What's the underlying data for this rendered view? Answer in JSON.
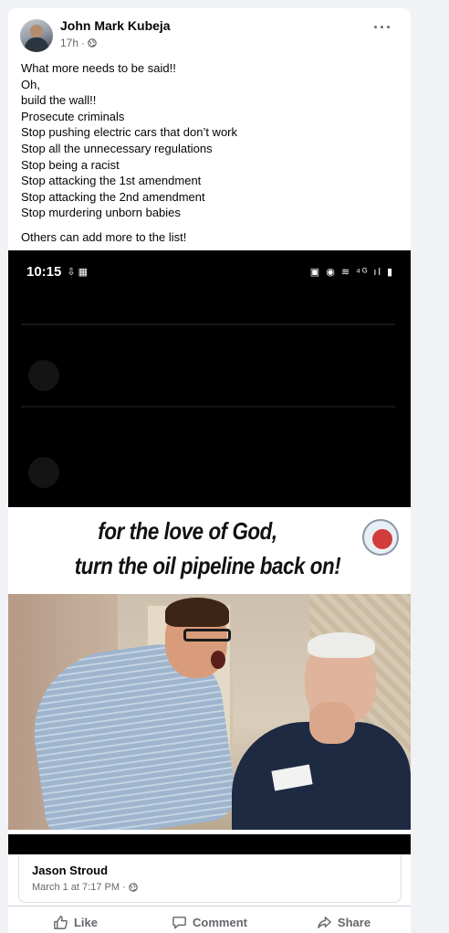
{
  "post": {
    "author": "John Mark Kubeja",
    "time": "17h",
    "separator": "·",
    "privacy_icon": "globe-icon",
    "more_icon": "more-options-icon",
    "more_label": "···",
    "lines": [
      "What more needs to be said!!",
      "Oh,",
      "build the wall!!",
      "Prosecute criminals",
      "Stop pushing electric cars that don’t work",
      "Stop all the unnecessary regulations",
      "Stop being a racist",
      "Stop attacking the 1st amendment",
      "Stop attacking the 2nd amendment",
      "Stop murdering unborn babies"
    ],
    "closing": "Others can add more to the list!"
  },
  "screenshot": {
    "time": "10:15",
    "left_icons": "⇩ ▦",
    "right_icons": "▣ ◉ ≋ ⁴ᴳ ıl ▮"
  },
  "meme": {
    "line1": "for the love of God,",
    "line2": "turn the oil pipeline back on!"
  },
  "shared_post": {
    "author": "Jason Stroud",
    "date": "March 1 at 7:17 PM",
    "separator": "·"
  },
  "actions": {
    "like": "Like",
    "comment": "Comment",
    "share": "Share"
  },
  "colors": {
    "background": "#f0f2f5",
    "card": "#ffffff",
    "text_primary": "#050505",
    "text_secondary": "#65676b",
    "divider": "#ced0d4"
  }
}
